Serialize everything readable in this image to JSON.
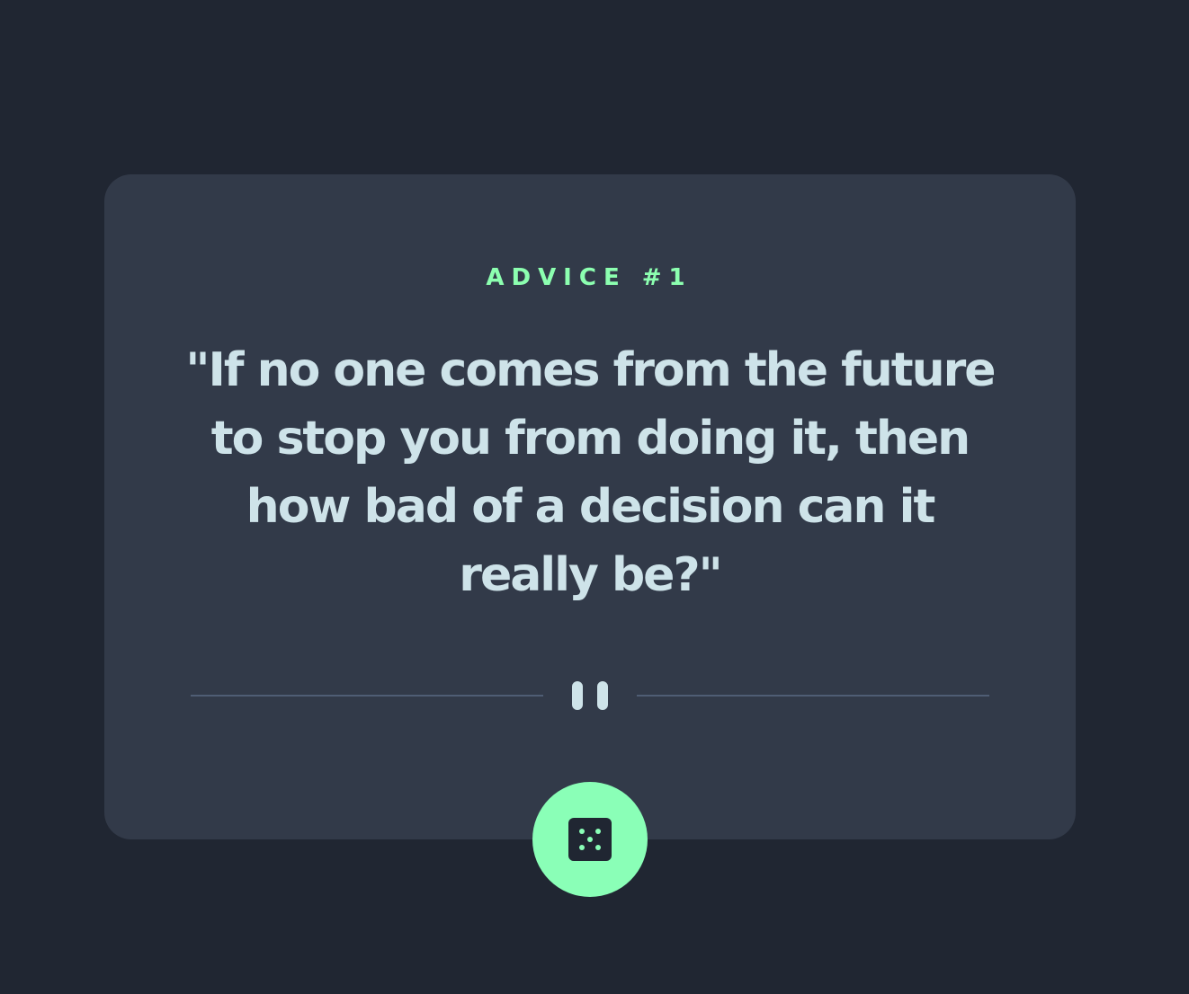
{
  "advice": {
    "label": "ADVICE #1",
    "quote": "\"If no one comes from the future to stop you from doing it, then how bad of a decision can it really be?\""
  },
  "icons": {
    "divider": "pause-icon",
    "button": "dice-icon"
  },
  "colors": {
    "background": "#202632",
    "card": "#323A49",
    "accent": "#8AFFB7",
    "text": "#CEE3E9",
    "divider": "#4F5D74"
  }
}
